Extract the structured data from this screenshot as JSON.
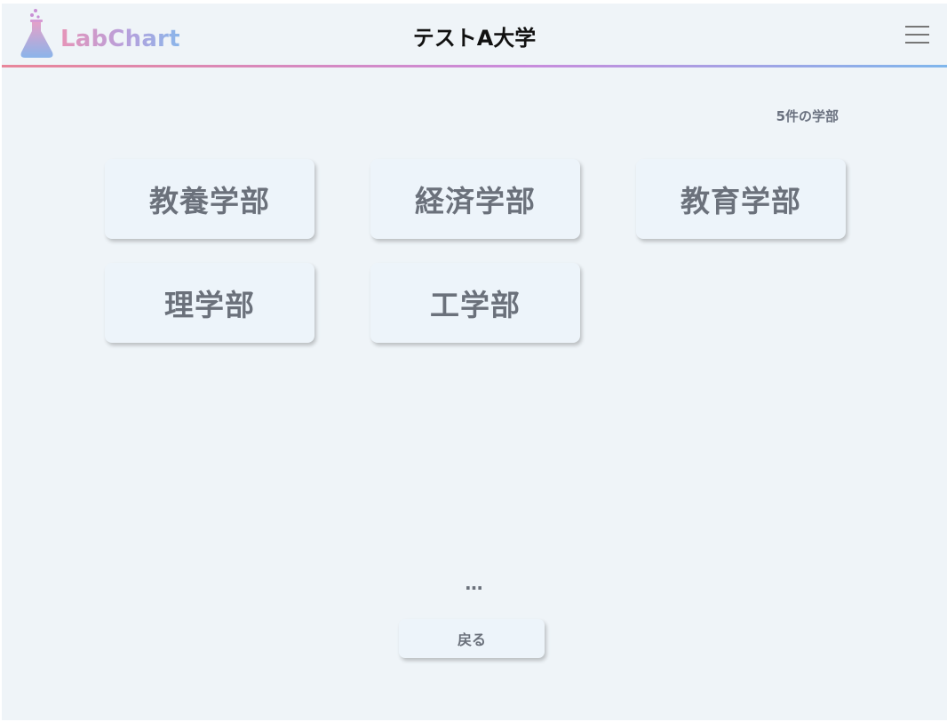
{
  "header": {
    "logo_text": "LabChart",
    "title": "テストA大学",
    "menu_icon": "hamburger-menu-icon",
    "logo_icon": "flask-icon"
  },
  "main": {
    "count_label": "5件の学部",
    "faculties": [
      {
        "label": "教養学部"
      },
      {
        "label": "経済学部"
      },
      {
        "label": "教育学部"
      },
      {
        "label": "理学部"
      },
      {
        "label": "工学部"
      }
    ],
    "pagination_ellipsis": "…",
    "back_label": "戻る"
  },
  "colors": {
    "background": "#eff4f8",
    "card_text": "#6b717b",
    "accent_gradient": [
      "#e8869a",
      "#c98bdc",
      "#7fb6ec"
    ]
  }
}
